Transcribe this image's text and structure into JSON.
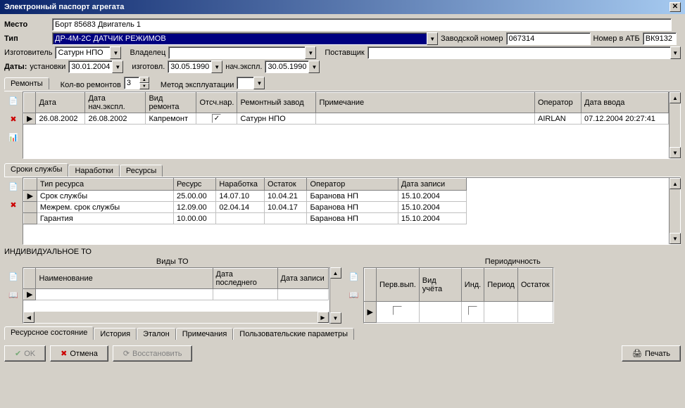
{
  "title": "Электронный паспорт агрегата",
  "fields": {
    "mesto_label": "Место",
    "mesto_value": "Борт 85683 Двигатель 1",
    "tip_label": "Тип",
    "tip_value": "ДР-4М-2С ДАТЧИК РЕЖИМОВ",
    "zavnomer_label": "Заводской номер",
    "zavnomer_value": "067314",
    "atb_label": "Номер в АТБ",
    "atb_value": "ВК9132",
    "izgot_label": "Изготовитель",
    "izgot_value": "Сатурн НПО",
    "vladel_label": "Владелец",
    "vladel_value": "",
    "postav_label": "Поставщик",
    "postav_value": "",
    "daty_label": "Даты:",
    "ust_label": "установки",
    "ust_value": "30.01.2004",
    "izg_label": "изготовл.",
    "izg_value": "30.05.1990",
    "nach_label": "нач.экспл.",
    "nach_value": "30.05.1990",
    "kolvo_label": "Кол-во ремонтов",
    "kolvo_value": "3",
    "metod_label": "Метод эксплуатации",
    "metod_value": ""
  },
  "tabs_top": {
    "remont": "Ремонты"
  },
  "repairs": {
    "headers": [
      "Дата",
      "Дата нач.экспл.",
      "Вид ремонта",
      "Отсч.нар.",
      "Ремонтный завод",
      "Примечание",
      "Оператор",
      "Дата ввода"
    ],
    "rows": [
      {
        "date": "26.08.2002",
        "dstart": "26.08.2002",
        "kind": "Капремонт",
        "chk": "✓",
        "plant": "Сатурн НПО",
        "note": "",
        "oper": "AIRLAN",
        "entered": "07.12.2004 20:27:41"
      }
    ]
  },
  "tabs_mid": {
    "sroki": "Сроки службы",
    "narab": "Наработки",
    "resursy": "Ресурсы"
  },
  "life": {
    "headers": [
      "Тип ресурса",
      "Ресурс",
      "Наработка",
      "Остаток",
      "Оператор",
      "Дата записи"
    ],
    "rows": [
      {
        "type": "Срок службы",
        "res": "25.00.00",
        "nar": "14.07.10",
        "ost": "10.04.21",
        "oper": "Баранова НП",
        "date": "15.10.2004"
      },
      {
        "type": "Межрем. срок службы",
        "res": "12.09.00",
        "nar": "02.04.14",
        "ost": "10.04.17",
        "oper": "Баранова НП",
        "date": "15.10.2004"
      },
      {
        "type": "Гарантия",
        "res": "10.00.00",
        "nar": "",
        "ost": "",
        "oper": "Баранова НП",
        "date": "15.10.2004"
      }
    ]
  },
  "indiv_label": "ИНДИВИДУАЛЬНОЕ ТО",
  "vidy_label": "Виды ТО",
  "period_label": "Периодичность",
  "to_headers": [
    "Наименование",
    "Дата последнего",
    "Дата записи"
  ],
  "period_headers": [
    "Перв.вып.",
    "Вид учёта",
    "Инд.",
    "Период",
    "Остаток"
  ],
  "tabs_bottom": {
    "res": "Ресурсное состояние",
    "hist": "История",
    "etalon": "Эталон",
    "prim": "Примечания",
    "user": "Пользовательские параметры"
  },
  "buttons": {
    "ok": "OK",
    "cancel": "Отмена",
    "restore": "Восстановить",
    "print": "Печать"
  }
}
